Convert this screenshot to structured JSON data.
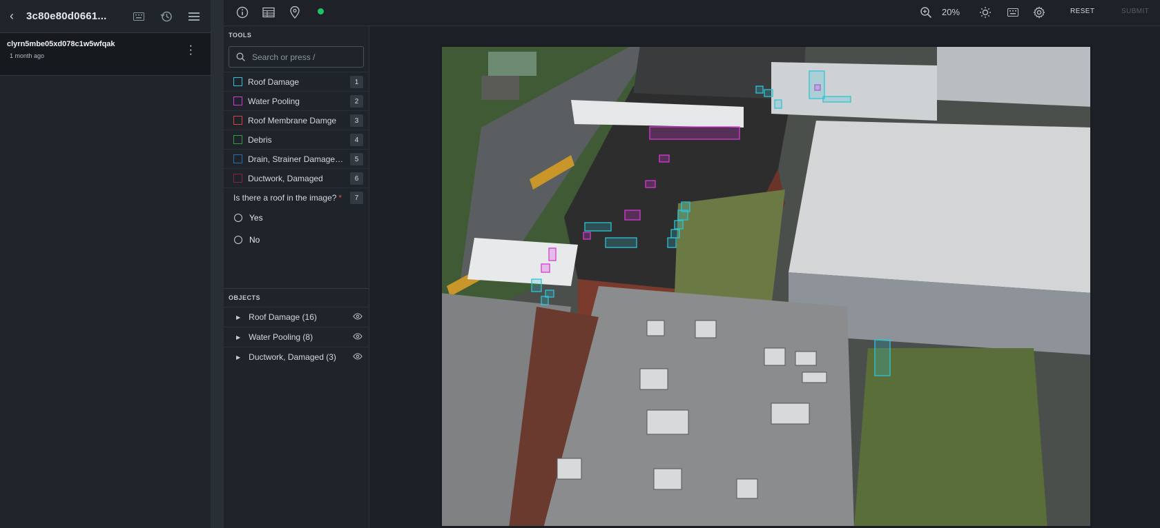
{
  "app": {
    "task_title": "3c80e80d0661...",
    "task": {
      "id": "clyrn5mbe05xd078c1w5wfqak",
      "time": "1 month ago"
    }
  },
  "toolbar": {
    "zoom": "20%",
    "reset_label": "RESET",
    "submit_label": "SUBMIT",
    "status_color": "#1fc26b"
  },
  "tools_panel": {
    "title": "TOOLS",
    "search_placeholder": "Search or press /",
    "tools": [
      {
        "label": "Roof Damage",
        "hotkey": "1",
        "color": "#2ec4d6"
      },
      {
        "label": "Water Pooling",
        "hotkey": "2",
        "color": "#d63ad6"
      },
      {
        "label": "Roof Membrane Damge",
        "hotkey": "3",
        "color": "#d64545"
      },
      {
        "label": "Debris",
        "hotkey": "4",
        "color": "#3a9a4a"
      },
      {
        "label": "Drain, Strainer Damaged / ...",
        "hotkey": "5",
        "color": "#2a6fa8"
      },
      {
        "label": "Ductwork, Damaged",
        "hotkey": "6",
        "color": "#8a2440"
      }
    ],
    "question": {
      "text": "Is there a roof in the image?",
      "required_mark": "*",
      "hotkey": "7",
      "options": [
        "Yes",
        "No"
      ]
    }
  },
  "objects_panel": {
    "title": "OBJECTS",
    "items": [
      {
        "label": "Roof Damage (16)"
      },
      {
        "label": "Water Pooling (8)"
      },
      {
        "label": "Ductwork, Damaged (3)"
      }
    ]
  },
  "annotations": {
    "roof_damage_color": "#2ec4d6",
    "water_pooling_color": "#d63ad6"
  }
}
